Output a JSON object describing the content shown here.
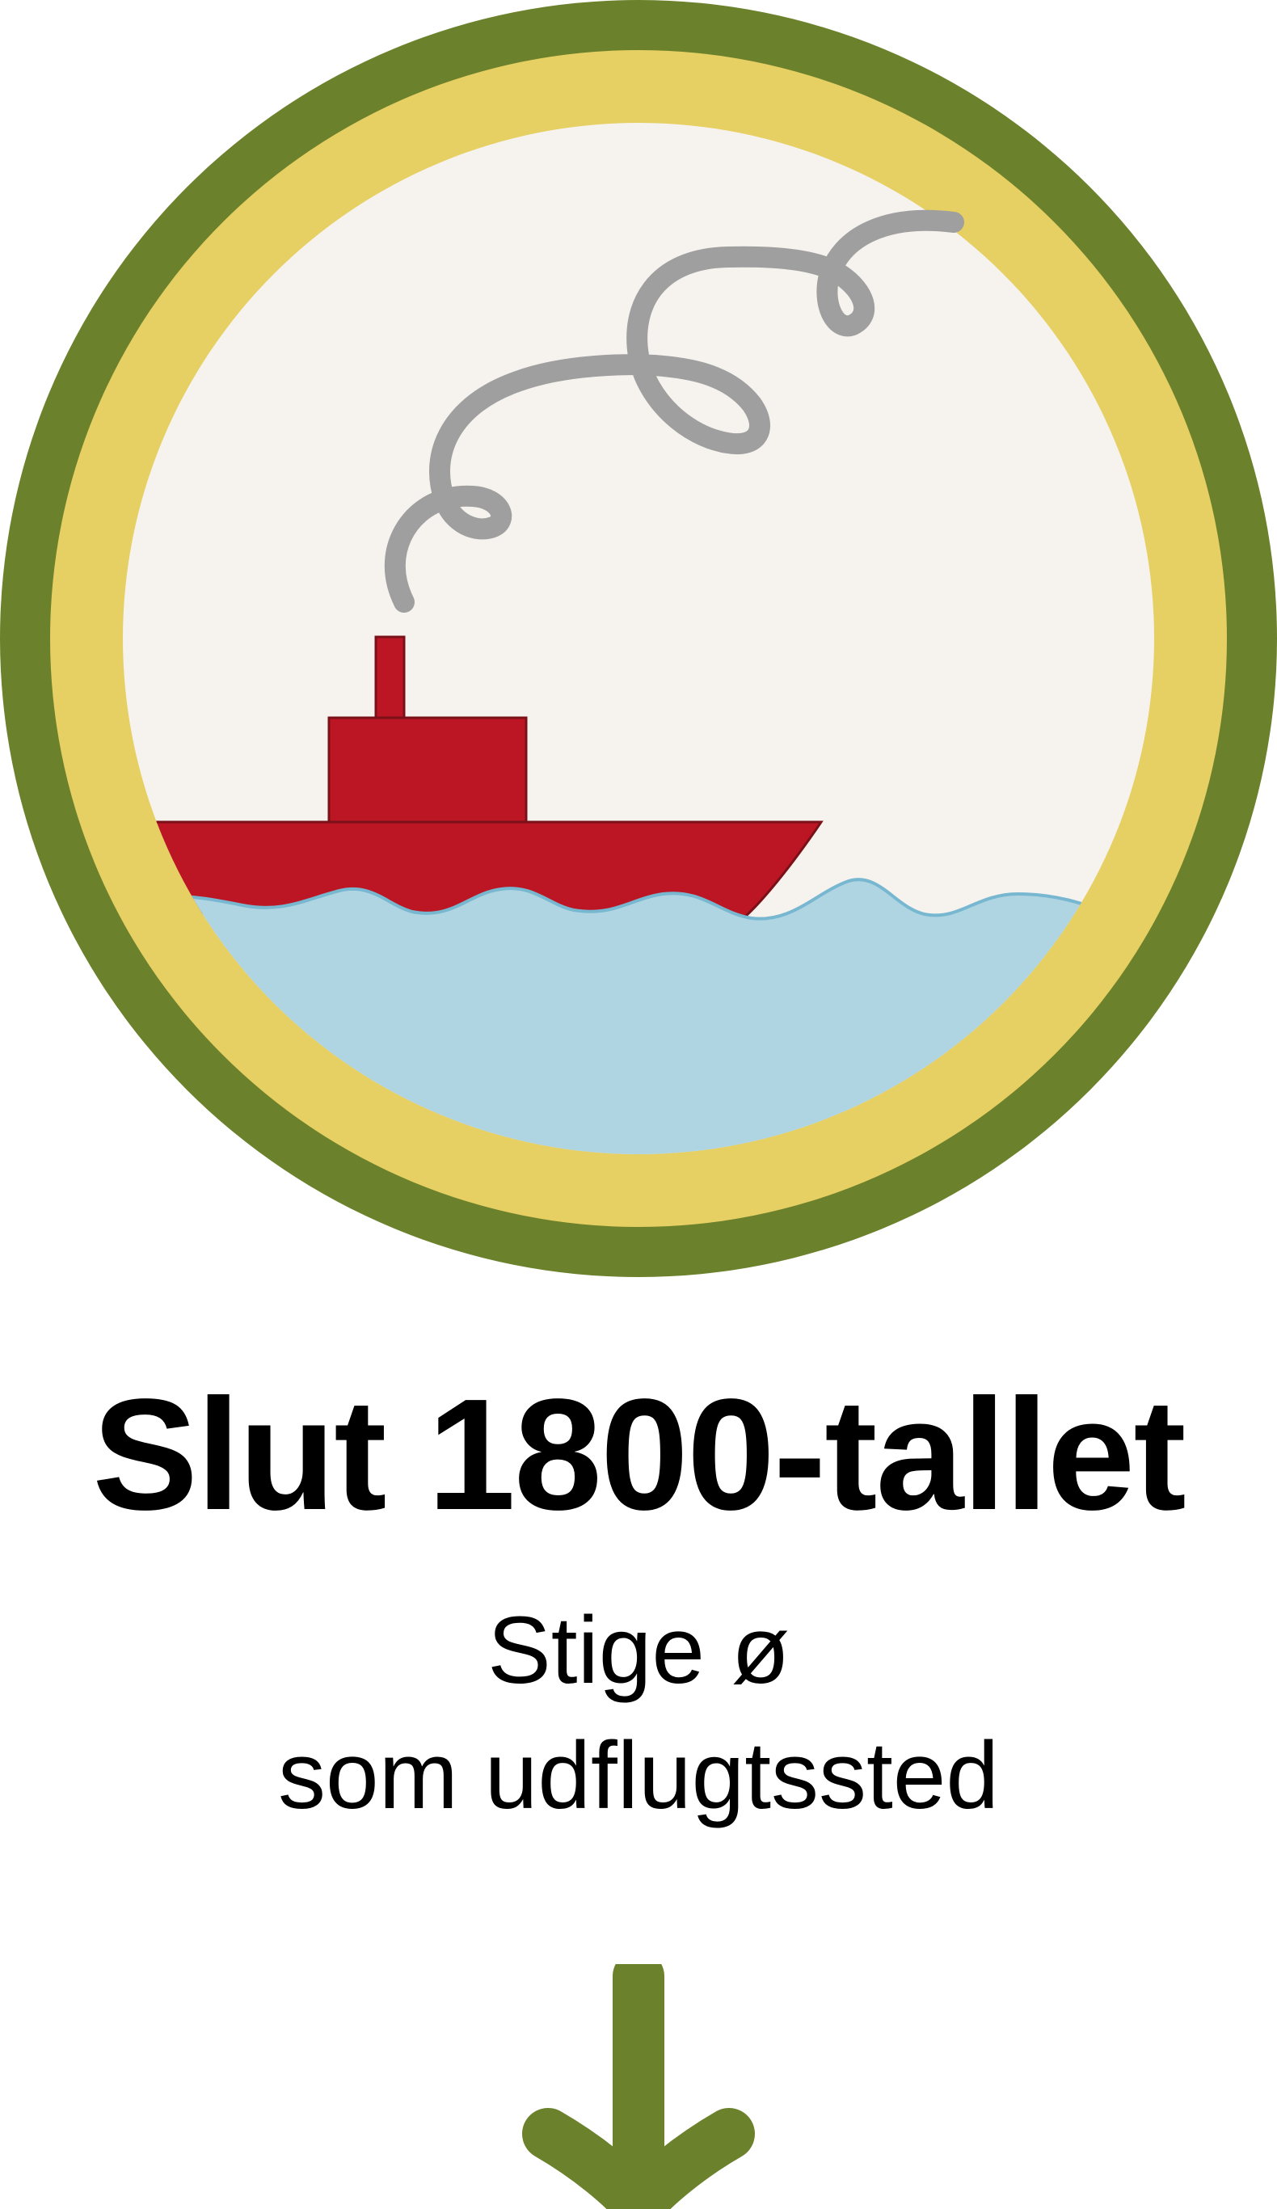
{
  "title": "Slut 1800-tallet",
  "subtitle": {
    "line1": "Stige ø",
    "line2": "som udflugtssted"
  },
  "colors": {
    "outer_ring": "#6c812b",
    "inner_ring": "#e6cf63",
    "sky": "#f6f3ef",
    "water": "#b0d5e2",
    "wave_line": "#78b7d0",
    "boat": "#bc1624",
    "boat_outline": "#7a1018",
    "smoke": "#9f9f9f",
    "arrow": "#6c812b"
  },
  "icons": {
    "badge": "steamboat-badge-icon",
    "arrow": "arrow-down-icon"
  }
}
